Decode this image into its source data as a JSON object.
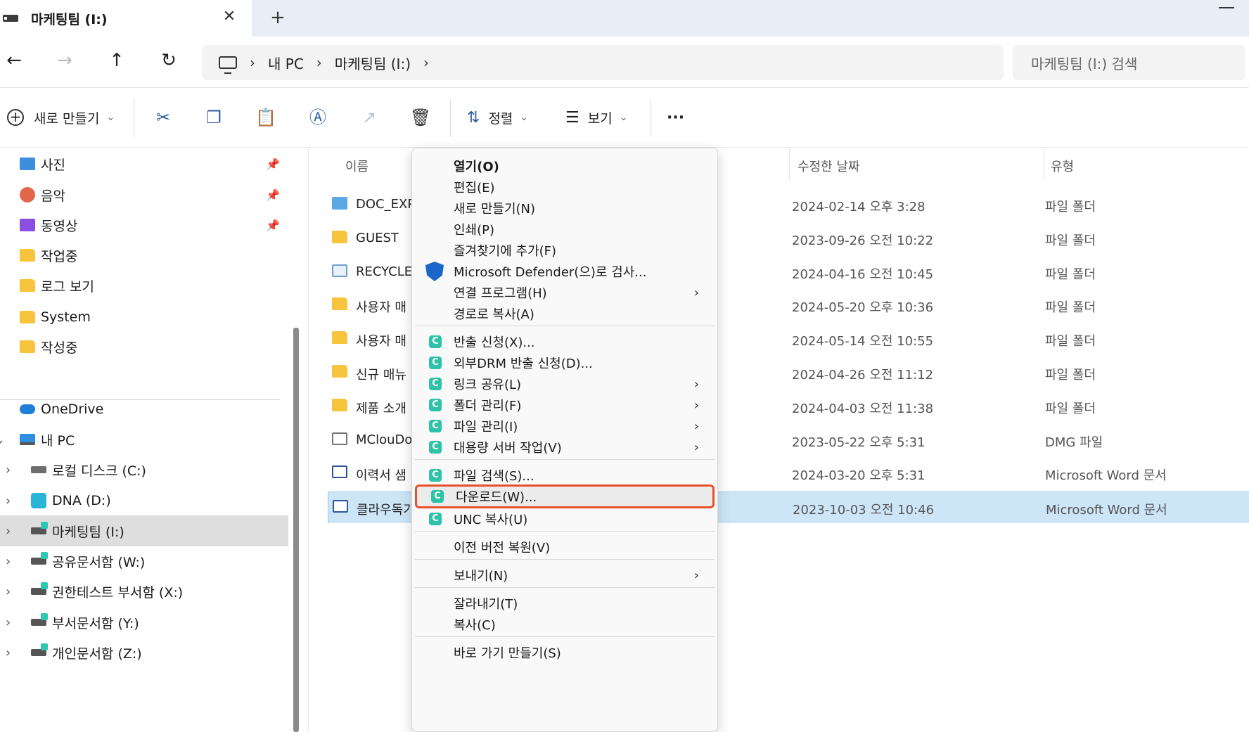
{
  "window": {
    "tab_title": "마케팅팀 (I:)",
    "close_glyph": "✕",
    "new_tab_glyph": "+"
  },
  "nav": {
    "back": "←",
    "forward": "→",
    "up": "↑",
    "refresh": "↻"
  },
  "address": {
    "crumbs": [
      "내 PC",
      "마케팅팀 (I:)"
    ],
    "separator": "›"
  },
  "search": {
    "placeholder": "마케팅팀 (I:) 검색"
  },
  "toolbar": {
    "new_label": "새로 만들기",
    "sort_label": "정렬",
    "view_label": "보기",
    "more_label": "···",
    "chevron": "⌄"
  },
  "sidebar": {
    "quick_access": [
      {
        "label": "사진",
        "icon": "photo",
        "pinned": true
      },
      {
        "label": "음악",
        "icon": "music",
        "pinned": true
      },
      {
        "label": "동영상",
        "icon": "video",
        "pinned": true
      },
      {
        "label": "작업중",
        "icon": "folder",
        "pinned": false
      },
      {
        "label": "로그 보기",
        "icon": "folder",
        "pinned": false
      },
      {
        "label": "System",
        "icon": "folder",
        "pinned": false
      },
      {
        "label": "작성중",
        "icon": "folder",
        "pinned": false
      }
    ],
    "tree": [
      {
        "label": "OneDrive",
        "icon": "cloud",
        "expander": "›"
      },
      {
        "label": "내 PC",
        "icon": "pc",
        "expander": "⌄"
      },
      {
        "label": "로컬 디스크 (C:)",
        "icon": "disk",
        "expander": "›"
      },
      {
        "label": "DNA (D:)",
        "icon": "dna",
        "expander": "›"
      },
      {
        "label": "마케팅팀 (I:)",
        "icon": "netdisk",
        "expander": "›",
        "selected": true
      },
      {
        "label": "공유문서함 (W:)",
        "icon": "netdisk",
        "expander": "›"
      },
      {
        "label": "권한테스트 부서함 (X:)",
        "icon": "netdisk",
        "expander": "›"
      },
      {
        "label": "부서문서함 (Y:)",
        "icon": "netdisk",
        "expander": "›"
      },
      {
        "label": "개인문서함 (Z:)",
        "icon": "netdisk",
        "expander": "›"
      }
    ],
    "pin_glyph": "📌"
  },
  "filelist": {
    "headers": {
      "name": "이름",
      "date": "수정한 날짜",
      "type": "유형"
    },
    "rows": [
      {
        "name": "DOC_EXPO",
        "date": "2024-02-14 오후 3:28",
        "type": "파일 폴더",
        "icon": "special"
      },
      {
        "name": "GUEST",
        "date": "2023-09-26 오전 10:22",
        "type": "파일 폴더",
        "icon": "folder"
      },
      {
        "name": "RECYCLER",
        "date": "2024-04-16 오전 10:45",
        "type": "파일 폴더",
        "icon": "recycle"
      },
      {
        "name": "사용자 매",
        "date": "2024-05-20 오후 10:36",
        "type": "파일 폴더",
        "icon": "folder"
      },
      {
        "name": "사용자 매",
        "date": "2024-05-14 오전 10:55",
        "type": "파일 폴더",
        "icon": "folder"
      },
      {
        "name": "신규 매뉴",
        "date": "2024-04-26 오전 11:12",
        "type": "파일 폴더",
        "icon": "folder"
      },
      {
        "name": "제품 소개",
        "date": "2024-04-03 오전 11:38",
        "type": "파일 폴더",
        "icon": "folder"
      },
      {
        "name": "MClouDoo",
        "date": "2023-05-22 오후 5:31",
        "type": "DMG 파일",
        "icon": "doc"
      },
      {
        "name": "이력서 샘",
        "date": "2024-03-20 오후 5:31",
        "type": "Microsoft Word 문서",
        "icon": "word"
      },
      {
        "name": "클라우독기",
        "date": "2023-10-03 오전 10:46",
        "type": "Microsoft Word 문서",
        "icon": "word",
        "selected": true
      }
    ]
  },
  "context_menu": {
    "items": [
      {
        "label": "열기(O)",
        "bold": true
      },
      {
        "label": "편집(E)"
      },
      {
        "label": "새로 만들기(N)"
      },
      {
        "label": "인쇄(P)"
      },
      {
        "label": "즐겨찾기에 추가(F)"
      },
      {
        "label": "Microsoft Defender(으)로 검사...",
        "icon": "shield"
      },
      {
        "label": "연결 프로그램(H)",
        "submenu": true
      },
      {
        "label": "경로로 복사(A)"
      },
      {
        "sep": true
      },
      {
        "label": "반출 신청(X)...",
        "icon": "c"
      },
      {
        "label": "외부DRM 반출 신청(D)...",
        "icon": "c"
      },
      {
        "label": "링크 공유(L)",
        "icon": "c",
        "submenu": true
      },
      {
        "label": "폴더 관리(F)",
        "icon": "c",
        "submenu": true
      },
      {
        "label": "파일 관리(I)",
        "icon": "c",
        "submenu": true
      },
      {
        "label": "대용량 서버 작업(V)",
        "icon": "c",
        "submenu": true
      },
      {
        "sep": true
      },
      {
        "label": "파일 검색(S)...",
        "icon": "c"
      },
      {
        "label": "다운로드(W)...",
        "icon": "c",
        "highlight": true
      },
      {
        "label": "UNC 복사(U)",
        "icon": "c"
      },
      {
        "sep": true
      },
      {
        "label": "이전 버전 복원(V)"
      },
      {
        "sep": true
      },
      {
        "label": "보내기(N)",
        "submenu": true
      },
      {
        "sep": true
      },
      {
        "label": "잘라내기(T)"
      },
      {
        "label": "복사(C)"
      },
      {
        "sep": true
      },
      {
        "label": "바로 가기 만들기(S)"
      }
    ],
    "arrow_glyph": "›",
    "c_glyph": "C"
  }
}
